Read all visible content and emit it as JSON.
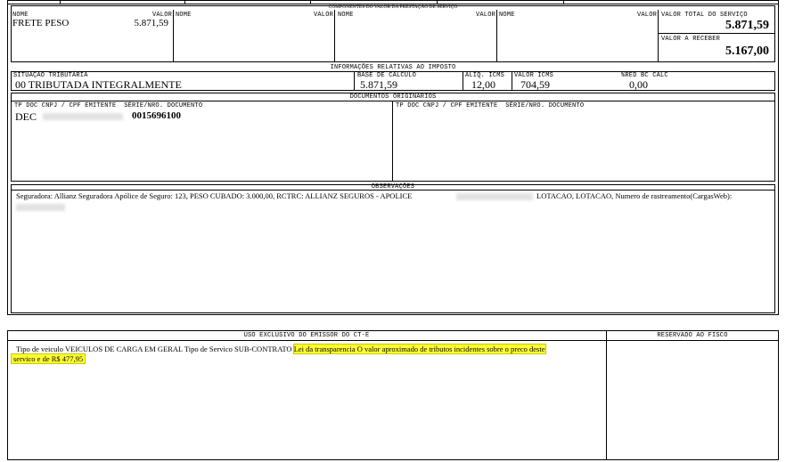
{
  "components": {
    "title": "COMPONENTES DO VALOR DA PRESTAÇÃO DE SERVIÇO",
    "name_label": "NOME",
    "value_label": "VALOR",
    "items": [
      {
        "name": "FRETE PESO",
        "value": "5.871,59"
      }
    ],
    "total_label": "VALOR TOTAL DO SERVIÇO",
    "total_value": "5.871,59",
    "receivable_label": "VALOR A RECEBER",
    "receivable_value": "5.167,00"
  },
  "tax": {
    "title": "INFORMAÇÕES RELATIVAS AO IMPOSTO",
    "situation_label": "SITUAÇÃO TRIBUTÁRIA",
    "situation_value": "00 TRIBUTADA INTEGRALMENTE",
    "base_label": "BASE DE CÁLCULO",
    "base_value": "5.871,59",
    "aliq_label": "ALÍQ. ICMS",
    "aliq_value": "12,00",
    "icms_label": "VALOR ICMS",
    "icms_value": "704,59",
    "red_label": "%RED BC CALC",
    "red_value": "0,00"
  },
  "docs": {
    "title": "DOCUMENTOS ORIGINÁRIOS",
    "col_label": "TP DOC CNPJ / CPF EMITENTE  SÉRIE/NRO. DOCUMENTO",
    "doc_type": "DEC",
    "doc_number": "0015696100"
  },
  "obs": {
    "title": "OBSERVAÇÕES",
    "text_part1": "Seguradora: Allianz Seguradora Apólice de Seguro: 123, PESO CUBADO: 3.000,00, RCTRC: ALLIANZ SEGUROS - APOLICE",
    "text_part2": "LOTACAO, LOTACAO, Numero de rastreamento(CargasWeb):"
  },
  "emissor": {
    "title": "USO EXCLUSIVO DO EMISSOR DO CT-E",
    "fisco_title": "RESERVADO AO FISCO",
    "text_plain": "Tipo de veiculo VEICULOS DE CARGA EM GERAL Tipo de Servico SUB-CONTRATO",
    "text_hl1": "Lei da transparencia O valor aproximado de tributos incidentes sobre o preco deste",
    "text_hl2": "servico e de R$ 477,95",
    "highlight_color": "#ffff33"
  }
}
